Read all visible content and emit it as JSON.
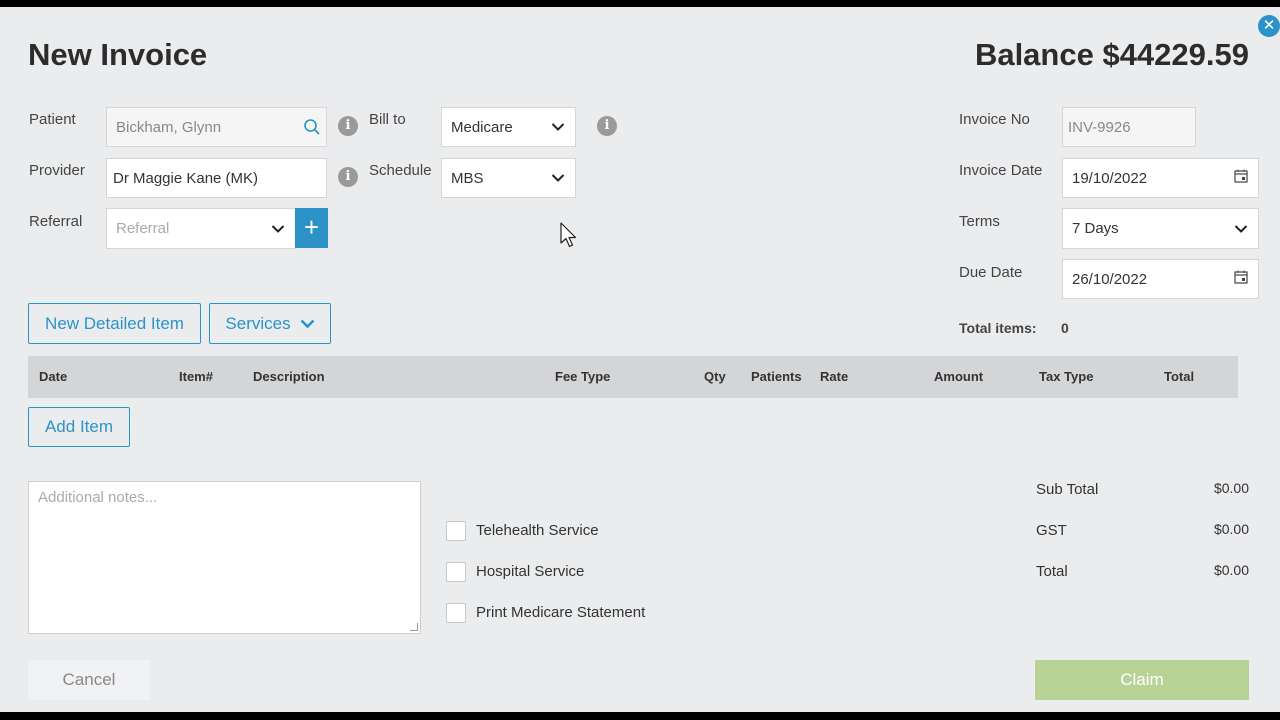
{
  "header": {
    "title": "New Invoice",
    "balance": "Balance $44229.59"
  },
  "patient": {
    "label": "Patient",
    "value": "Bickham, Glynn"
  },
  "provider": {
    "label": "Provider",
    "value": "Dr Maggie Kane (MK)"
  },
  "referral": {
    "label": "Referral",
    "placeholder": "Referral"
  },
  "bill_to": {
    "label": "Bill to",
    "value": "Medicare"
  },
  "schedule": {
    "label": "Schedule",
    "value": "MBS"
  },
  "invoice_no": {
    "label": "Invoice No",
    "value": "INV-9926"
  },
  "invoice_date": {
    "label": "Invoice Date",
    "value": "19/10/2022"
  },
  "terms": {
    "label": "Terms",
    "value": "7 Days"
  },
  "due_date": {
    "label": "Due Date",
    "value": "26/10/2022"
  },
  "buttons": {
    "new_detailed_item": "New Detailed Item",
    "services": "Services",
    "add_item": "Add Item",
    "cancel": "Cancel",
    "claim": "Claim"
  },
  "total_items": {
    "label": "Total items:",
    "value": "0"
  },
  "table": {
    "columns": [
      "Date",
      "Item#",
      "Description",
      "Fee Type",
      "Qty",
      "Patients",
      "Rate",
      "Amount",
      "Tax Type",
      "Total"
    ]
  },
  "notes": {
    "placeholder": "Additional notes..."
  },
  "options": {
    "telehealth": "Telehealth Service",
    "hospital": "Hospital Service",
    "print_statement": "Print Medicare Statement"
  },
  "summary": {
    "sub_total_label": "Sub Total",
    "sub_total": "$0.00",
    "gst_label": "GST",
    "gst": "$0.00",
    "total_label": "Total",
    "total": "$0.00"
  },
  "colors": {
    "accent": "#2b93c7",
    "claim": "#b9d396",
    "background": "#ebecee"
  }
}
